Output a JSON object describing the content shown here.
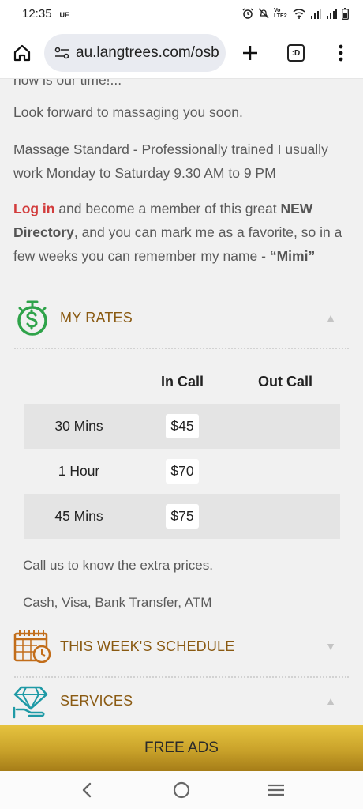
{
  "status": {
    "time": "12:35",
    "carrier": "UE",
    "icons": [
      "alarm-icon",
      "mute-icon",
      "volte-icon",
      "wifi-icon",
      "signal-icon",
      "signal-icon",
      "battery-icon"
    ],
    "volte_label": "Vo LTE2"
  },
  "browser": {
    "url": "au.langtrees.com/osb",
    "tab_label": ":D",
    "icons": [
      "home-icon",
      "site-settings-icon",
      "plus-icon",
      "tab-switcher-icon",
      "more-vert-icon"
    ]
  },
  "content": {
    "partial_line": "now is our time!...",
    "look_forward": "Look forward to massaging you soon.",
    "standard": " Massage Standard - Professionally trained I usually work Monday to Saturday 9.30 AM to 9 PM",
    "member": {
      "login": "Log in",
      "text1": " and become a member of this great ",
      "new_dir": "NEW Directory",
      "text2": ", and you can mark me as a favorite, so in a few weeks you can remember my name - ",
      "name": "“Mimi”"
    }
  },
  "rates": {
    "title": "MY RATES",
    "icon": "money-clock-icon",
    "arrow": "▲",
    "col_incall": "In Call",
    "col_outcall": "Out Call",
    "rows": [
      {
        "duration": "30 Mins",
        "incall": "$45",
        "outcall": ""
      },
      {
        "duration": "1 Hour",
        "incall": "$70",
        "outcall": ""
      },
      {
        "duration": "45 Mins",
        "incall": "$75",
        "outcall": ""
      }
    ],
    "extra": "Call us to know the extra prices.",
    "payment": "Cash, Visa, Bank Transfer, ATM"
  },
  "schedule": {
    "title": "THIS WEEK'S SCHEDULE",
    "icon": "calendar-clock-icon",
    "arrow": "▼"
  },
  "services": {
    "title": "SERVICES",
    "icon": "diamond-hand-icon",
    "arrow": "▲"
  },
  "banner": {
    "label": "FREE ADS"
  },
  "nav": {
    "icons": [
      "back-icon",
      "home-circle-icon",
      "recents-icon"
    ]
  },
  "colors": {
    "accent_text": "#8a5a12",
    "login": "#d23c3c",
    "banner_gold": "#c9a22a",
    "icon_green": "#2fa34a",
    "icon_orange": "#c26d1a",
    "icon_teal": "#1f9aa6"
  }
}
